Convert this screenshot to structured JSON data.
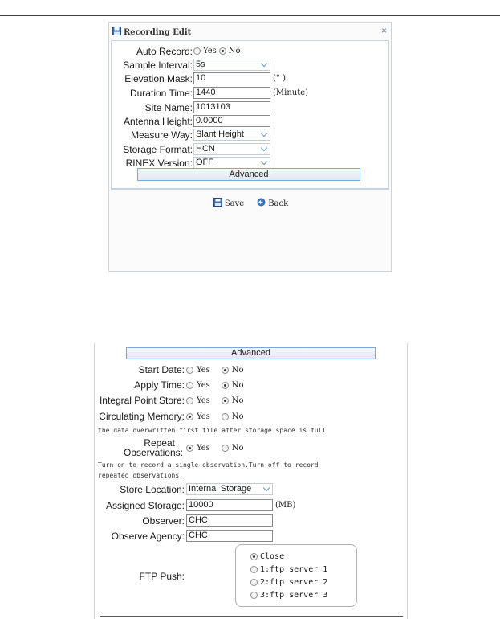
{
  "dialog": {
    "title": "Recording Edit",
    "close_label": "×",
    "auto_record": {
      "label": "Auto Record:",
      "options": [
        "Yes",
        "No"
      ],
      "selected": "No"
    },
    "sample_interval": {
      "label": "Sample Interval:",
      "value": "5s"
    },
    "elevation_mask": {
      "label": "Elevation Mask:",
      "value": "10",
      "unit": "(° )"
    },
    "duration_time": {
      "label": "Duration Time:",
      "value": "1440",
      "unit": "(Minute)"
    },
    "site_name": {
      "label": "Site Name:",
      "value": "1013103"
    },
    "antenna_height": {
      "label": "Antenna Height:",
      "value": "0.0000"
    },
    "measure_way": {
      "label": "Measure Way:",
      "value": "Slant Height"
    },
    "storage_format": {
      "label": "Storage Format:",
      "value": "HCN"
    },
    "rinex_version": {
      "label": "RINEX Version:",
      "value": "OFF"
    },
    "advanced_label": "Advanced",
    "save_label": "Save",
    "back_label": "Back"
  },
  "advanced": {
    "button_label": "Advanced",
    "start_date": {
      "label": "Start Date:",
      "options": [
        "Yes",
        "No"
      ],
      "selected": "No"
    },
    "apply_time": {
      "label": "Apply Time:",
      "options": [
        "Yes",
        "No"
      ],
      "selected": "No"
    },
    "integral_point_store": {
      "label": "Integral Point Store:",
      "options": [
        "Yes",
        "No"
      ],
      "selected": "No"
    },
    "circulating_memory": {
      "label": "Circulating Memory:",
      "options": [
        "Yes",
        "No"
      ],
      "selected": "Yes"
    },
    "circulating_note": "the data overwritten first file after storage space is full",
    "repeat_observations": {
      "label_line1": "Repeat",
      "label_line2": "Observations:",
      "options": [
        "Yes",
        "No"
      ],
      "selected": "Yes"
    },
    "repeat_note_line1": "Turn on to record a single observation.Turn off to record",
    "repeat_note_line2": "repeated observations.",
    "store_location": {
      "label": "Store Location:",
      "value": "Internal Storage"
    },
    "assigned_storage": {
      "label": "Assigned Storage:",
      "value": "10000",
      "unit": "(MB)"
    },
    "observer": {
      "label": "Observer:",
      "value": "CHC"
    },
    "observe_agency": {
      "label": "Observe Agency:",
      "value": "CHC"
    },
    "ftp_push": {
      "label": "FTP Push:",
      "options": [
        "Close",
        "1:ftp server 1",
        "2:ftp server 2",
        "3:ftp server 3"
      ],
      "selected": "Close"
    }
  },
  "colors": {
    "accent": "#5b86c9",
    "button_border": "#7da7d8",
    "panel_border": "#c6d5e6"
  }
}
